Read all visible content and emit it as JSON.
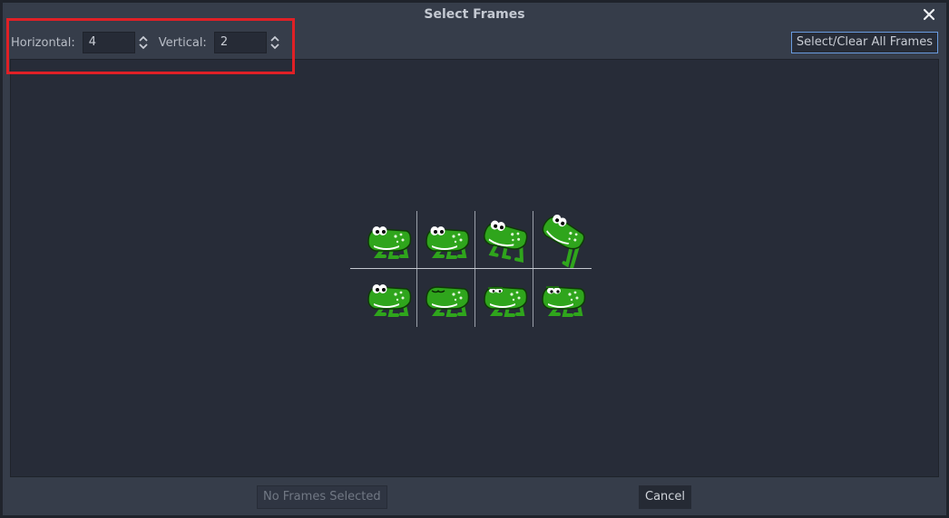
{
  "dialog": {
    "title": "Select Frames",
    "close_icon": "close-icon"
  },
  "toolbar": {
    "horizontal_label": "Horizontal:",
    "horizontal_value": "4",
    "vertical_label": "Vertical:",
    "vertical_value": "2",
    "spin_icon": "updown-arrows-icon",
    "select_clear_label": "Select/Clear All Frames"
  },
  "sheet": {
    "columns": 4,
    "rows": 2,
    "frames": [
      {
        "row": 0,
        "col": 0,
        "pose": "sit"
      },
      {
        "row": 0,
        "col": 1,
        "pose": "crouch"
      },
      {
        "row": 0,
        "col": 2,
        "pose": "lift"
      },
      {
        "row": 0,
        "col": 3,
        "pose": "jump"
      },
      {
        "row": 1,
        "col": 0,
        "pose": "sit"
      },
      {
        "row": 1,
        "col": 1,
        "pose": "blink-closed"
      },
      {
        "row": 1,
        "col": 2,
        "pose": "blink-half"
      },
      {
        "row": 1,
        "col": 3,
        "pose": "blink-open"
      }
    ]
  },
  "footer": {
    "confirm_label": "No Frames Selected",
    "cancel_label": "Cancel"
  },
  "colors": {
    "accent_border": "#6a9ce0",
    "highlight_annotation": "#e02026",
    "frog_green": "#2fa51c"
  }
}
